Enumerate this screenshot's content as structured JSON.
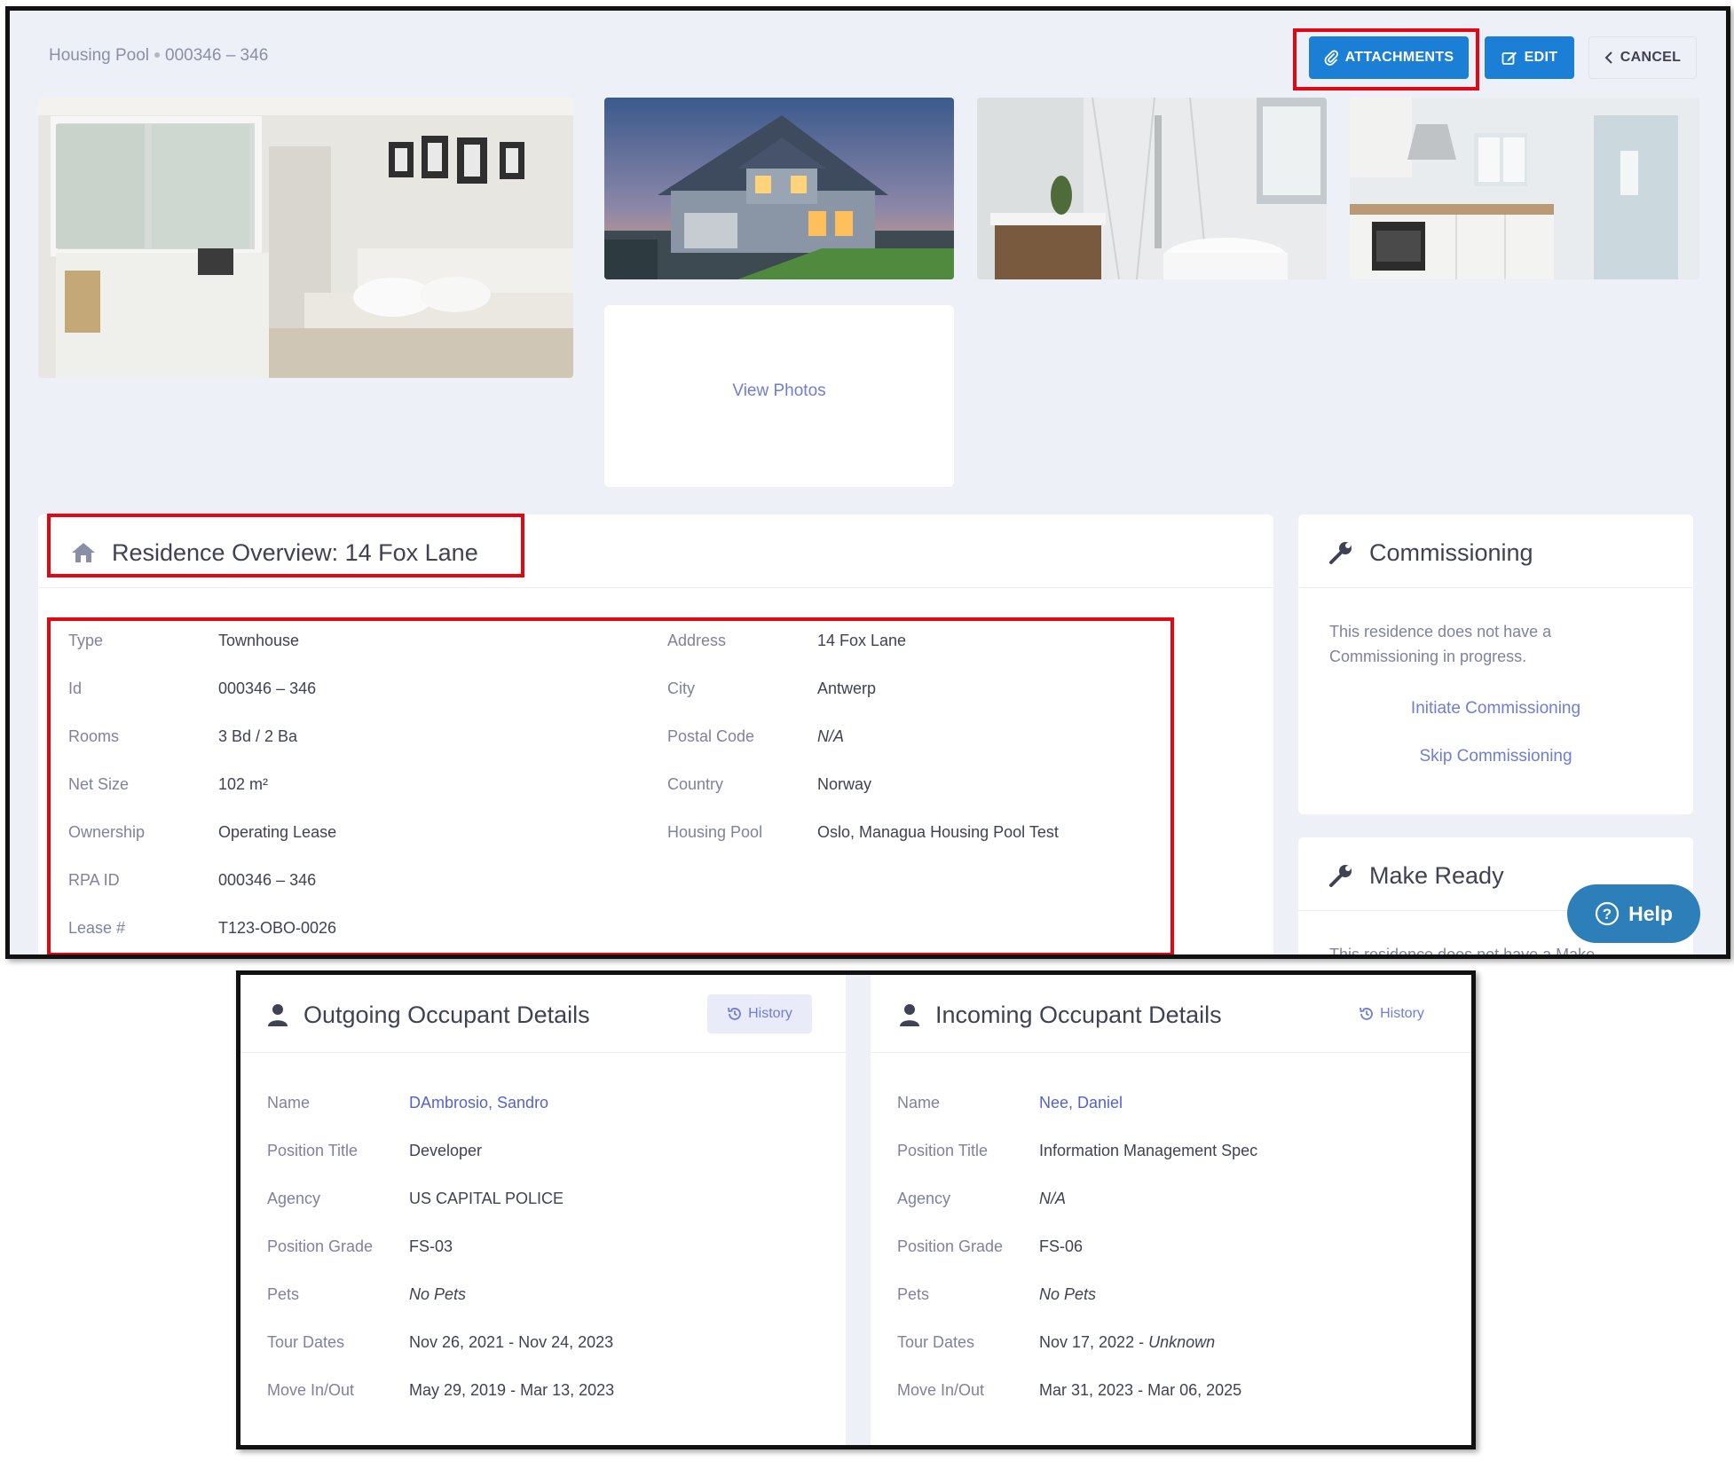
{
  "breadcrumb": {
    "section": "Housing Pool",
    "id": "000346 – 346"
  },
  "toolbar": {
    "attachments": "ATTACHMENTS",
    "edit": "EDIT",
    "cancel": "CANCEL"
  },
  "photos": {
    "view_photos": "View Photos"
  },
  "overview": {
    "title": "Residence Overview: 14 Fox Lane",
    "left": [
      {
        "label": "Type",
        "value": "Townhouse"
      },
      {
        "label": "Id",
        "value": "000346 – 346"
      },
      {
        "label": "Rooms",
        "value": "3 Bd / 2 Ba"
      },
      {
        "label": "Net Size",
        "value": "102 m²"
      },
      {
        "label": "Ownership",
        "value": "Operating Lease"
      },
      {
        "label": "RPA ID",
        "value": "000346 – 346"
      },
      {
        "label": "Lease #",
        "value": "T123-OBO-0026"
      }
    ],
    "right": [
      {
        "label": "Address",
        "value": "14 Fox Lane"
      },
      {
        "label": "City",
        "value": "Antwerp"
      },
      {
        "label": "Postal Code",
        "value": "N/A"
      },
      {
        "label": "Country",
        "value": "Norway"
      },
      {
        "label": "Housing Pool",
        "value": "Oslo, Managua Housing Pool Test"
      }
    ]
  },
  "commissioning": {
    "title": "Commissioning",
    "message_line1": "This residence does not have a",
    "message_line2": "Commissioning in progress.",
    "initiate": "Initiate Commissioning",
    "skip": "Skip Commissioning"
  },
  "make_ready": {
    "title": "Make Ready",
    "message": "This residence does not have a Make"
  },
  "help": {
    "label": "Help"
  },
  "outgoing": {
    "title": "Outgoing Occupant Details",
    "history": "History",
    "rows": [
      {
        "label": "Name",
        "value": "DAmbrosio, Sandro"
      },
      {
        "label": "Position Title",
        "value": "Developer"
      },
      {
        "label": "Agency",
        "value": "US CAPITAL POLICE"
      },
      {
        "label": "Position Grade",
        "value": "FS-03"
      },
      {
        "label": "Pets",
        "value": "No Pets"
      },
      {
        "label": "Tour Dates",
        "value": "Nov 26, 2021 - Nov 24, 2023"
      },
      {
        "label": "Move In/Out",
        "value": "May 29, 2019 - Mar 13, 2023"
      }
    ]
  },
  "incoming": {
    "title": "Incoming Occupant Details",
    "history": "History",
    "rows": [
      {
        "label": "Name",
        "value": "Nee, Daniel"
      },
      {
        "label": "Position Title",
        "value": "Information Management Spec"
      },
      {
        "label": "Agency",
        "value": "N/A"
      },
      {
        "label": "Position Grade",
        "value": "FS-06"
      },
      {
        "label": "Pets",
        "value": "No Pets"
      },
      {
        "label": "Tour Dates",
        "value": "Nov 17, 2022 - "
      },
      {
        "label": "Tour Dates Unknown",
        "value": "Unknown"
      },
      {
        "label": "Move In/Out",
        "value": "Mar 31, 2023 - Mar 06, 2025"
      }
    ]
  },
  "colors": {
    "primary": "#1b7fd6",
    "highlight": "#e30613",
    "link": "#6f7dd6",
    "help": "#2c7fb8"
  }
}
